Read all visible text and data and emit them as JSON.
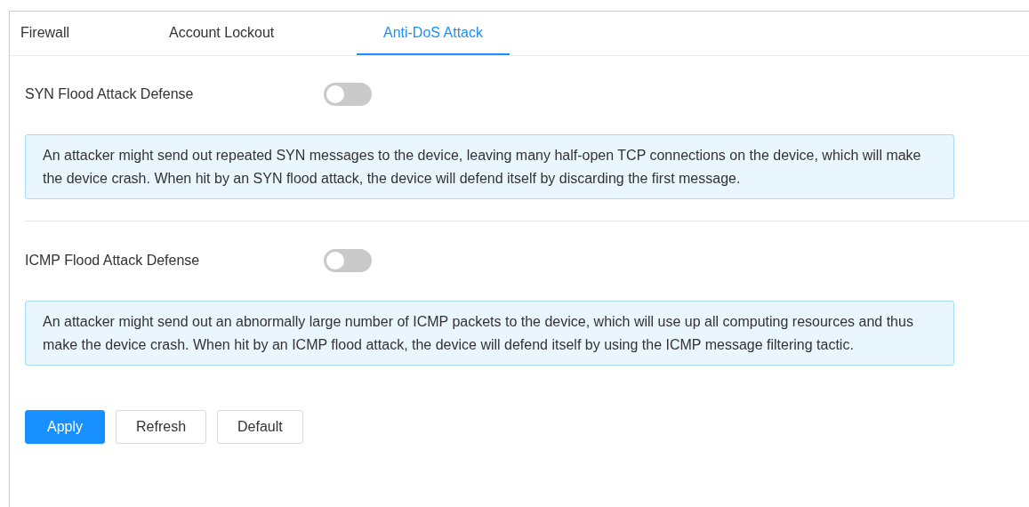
{
  "tabs": [
    {
      "label": "Firewall",
      "selected": false
    },
    {
      "label": "Account Lockout",
      "selected": false
    },
    {
      "label": "Anti-DoS Attack",
      "selected": true
    }
  ],
  "sections": [
    {
      "label": "SYN Flood Attack Defense",
      "on": false,
      "info": "An attacker might send out repeated SYN messages to the device, leaving many half-open TCP connections on the device, which will make the device crash. When hit by an SYN flood attack, the device will defend itself by discarding the first message."
    },
    {
      "label": "ICMP Flood Attack Defense",
      "on": false,
      "info": "An attacker might send out an abnormally large number of ICMP packets to the device, which will use up all computing resources and thus make the device crash. When hit by an ICMP flood attack, the device will defend itself by using the ICMP message filtering tactic."
    }
  ],
  "buttons": [
    {
      "label": "Apply",
      "kind": "primary"
    },
    {
      "label": "Refresh",
      "kind": "default"
    },
    {
      "label": "Default",
      "kind": "default"
    }
  ]
}
